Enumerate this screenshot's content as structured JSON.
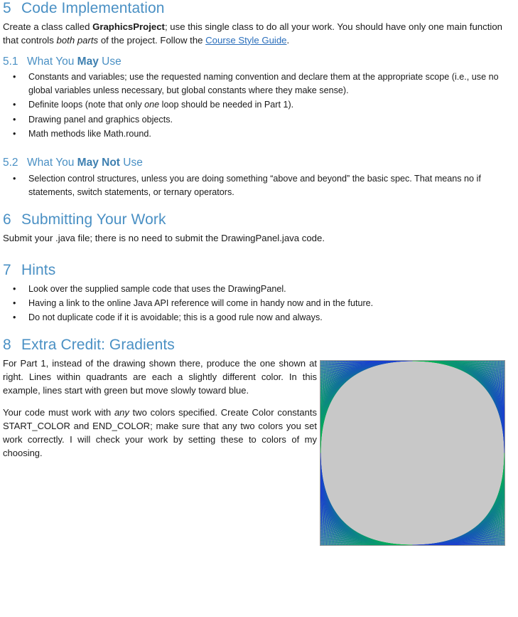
{
  "document": {
    "theme": {
      "heading_color": "#4a90c4",
      "link_color": "#2a6ebb",
      "body_color": "#1a1a1a",
      "panel_background": "#c8c8c8"
    },
    "sections": [
      {
        "number": "5",
        "title": "Code Implementation",
        "paragraph_part1": "Create a class called ",
        "paragraph_bold1": "GraphicsProject",
        "paragraph_part2": "; use this single class to do all your work.  You should have only one main function that controls ",
        "paragraph_italic1": "both parts",
        "paragraph_part3": " of the project.  Follow the ",
        "link_text": "Course Style Guide",
        "paragraph_part4": "."
      },
      {
        "number": "5.1",
        "title_prefix": "What You ",
        "title_bold": "May",
        "title_suffix": " Use",
        "bullets": [
          {
            "part1": "Constants and variables; use the requested naming convention and declare them at the appropriate scope (i.e., use no global variables unless necessary, but global constants where they make sense)."
          },
          {
            "part1": "Definite loops (note that only ",
            "italic": "one",
            "part2": " loop should be needed in Part 1)."
          },
          {
            "part1": "Drawing panel and graphics objects."
          },
          {
            "part1": "Math methods like Math.round."
          }
        ]
      },
      {
        "number": "5.2",
        "title_prefix": "What You ",
        "title_bold": "May Not",
        "title_suffix": " Use",
        "bullets": [
          {
            "part1": "Selection control structures, unless you are doing something “above and beyond” the basic spec.  That means no if statements, switch statements, or ternary operators."
          }
        ]
      },
      {
        "number": "6",
        "title": "Submitting Your Work",
        "paragraph": "Submit your .java file; there is no need to submit the DrawingPanel.java code."
      },
      {
        "number": "7",
        "title": "Hints",
        "bullets": [
          {
            "part1": "Look over the supplied sample code that uses the DrawingPanel."
          },
          {
            "part1": "Having a link to the online Java API reference will come in handy now and in the future."
          },
          {
            "part1": "Do not duplicate code if it is avoidable; this is a good rule now and always."
          }
        ]
      },
      {
        "number": "8",
        "title": "Extra Credit:  Gradients",
        "paragraph1_part1": "For Part 1, instead of the drawing shown there, produce the one shown at right.  Lines within quadrants are each a slightly different color. In this example, lines start with green but move slowly toward blue.",
        "paragraph2_part1": "Your code must work with ",
        "paragraph2_italic": "any",
        "paragraph2_part2": " two colors specified. Create Color constants START_COLOR and END_COLOR; make sure that any two colors you set work correctly.  I will check your work by setting these to colors of my choosing."
      }
    ],
    "bullet_glyph": "•",
    "figure": {
      "caption": "",
      "start_color": "#00c83c",
      "end_color": "#1a3cd2",
      "background": "#c8c8c8",
      "line_count": 60,
      "size": 261
    }
  }
}
